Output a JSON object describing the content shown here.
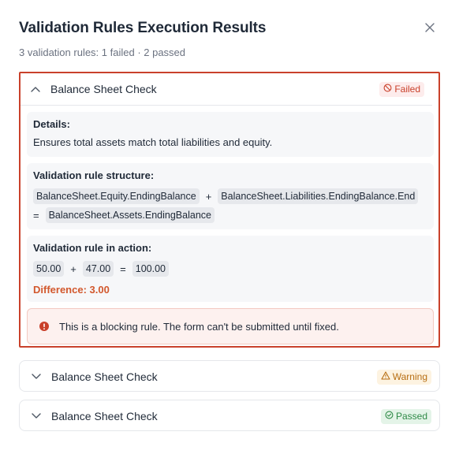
{
  "dialog": {
    "title": "Validation Rules Execution Results",
    "subtitle": "3 validation rules: 1 failed · 2 passed"
  },
  "icons": {
    "close": "close-icon",
    "chevron_up": "chevron-up-icon",
    "chevron_down": "chevron-down-icon",
    "failed": "ban-icon",
    "warning": "warning-triangle-icon",
    "passed": "check-circle-icon",
    "alert": "exclamation-circle-icon"
  },
  "colors": {
    "failed": "#c9412b",
    "warning": "#b76e12",
    "passed": "#2f8a47",
    "difference": "#d2582d"
  },
  "rules": [
    {
      "title": "Balance Sheet Check",
      "status": "Failed",
      "details_label": "Details:",
      "details_text": "Ensures total assets match total liabilities and equity.",
      "structure_label": "Validation rule structure:",
      "structure": {
        "a": "BalanceSheet.Equity.EndingBalance",
        "op1": "+",
        "b": "BalanceSheet.Liabilities.EndingBalance.End",
        "eq": "=",
        "c": "BalanceSheet.Assets.EndingBalance"
      },
      "action_label": "Validation rule in action:",
      "action": {
        "a": "50.00",
        "op1": "+",
        "b": "47.00",
        "eq": "=",
        "c": "100.00"
      },
      "difference": "Difference: 3.00",
      "alert": "This is a blocking rule. The form can't be submitted until fixed."
    },
    {
      "title": "Balance Sheet Check",
      "status": "Warning"
    },
    {
      "title": "Balance Sheet Check",
      "status": "Passed"
    }
  ]
}
